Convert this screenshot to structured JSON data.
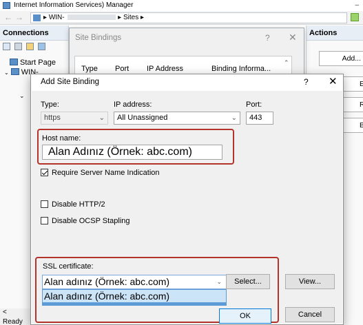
{
  "iis": {
    "title": "Internet Information Services) Manager",
    "minimize": "–",
    "address": {
      "back": "←",
      "forward": "→",
      "server": "WIN-",
      "sep": "▸",
      "sites": "Sites",
      "sep2": "▸"
    },
    "connections": {
      "header": "Connections",
      "tree": [
        "Start Page",
        "WIN-"
      ]
    },
    "actions": {
      "header": "Actions",
      "buttons": [
        "Add...",
        "Edit...",
        "Remov",
        "Browse"
      ]
    },
    "status": {
      "chevron": "<",
      "ready": "Ready"
    }
  },
  "site_bindings": {
    "title": "Site Bindings",
    "help": "?",
    "close": "✕",
    "columns": [
      "Type",
      "Port",
      "IP Address",
      "Binding Informa..."
    ]
  },
  "add_binding": {
    "title": "Add Site Binding",
    "help": "?",
    "close": "✕",
    "type_label": "Type:",
    "type_value": "https",
    "ip_label": "IP address:",
    "ip_value": "All Unassigned",
    "port_label": "Port:",
    "port_value": "443",
    "host_label": "Host name:",
    "host_value": "Alan Adınız (Örnek: abc.com)",
    "sni_label": "Require Server Name Indication",
    "sni_checked": true,
    "http2_label": "Disable HTTP/2",
    "http2_checked": false,
    "ocsp_label": "Disable OCSP Stapling",
    "ocsp_checked": false,
    "ssl_label": "SSL certificate:",
    "ssl_value": "Alan adınız (Örnek: abc.com)",
    "ssl_option": "Alan adınız (Örnek: abc.com)",
    "select_button": "Select...",
    "view_button": "View...",
    "ok_button": "OK",
    "cancel_button": "Cancel"
  },
  "colors": {
    "highlight_border": "#b3322a",
    "dropdown_selection": "#cce4f7",
    "primary_button_border": "#0078d7"
  }
}
